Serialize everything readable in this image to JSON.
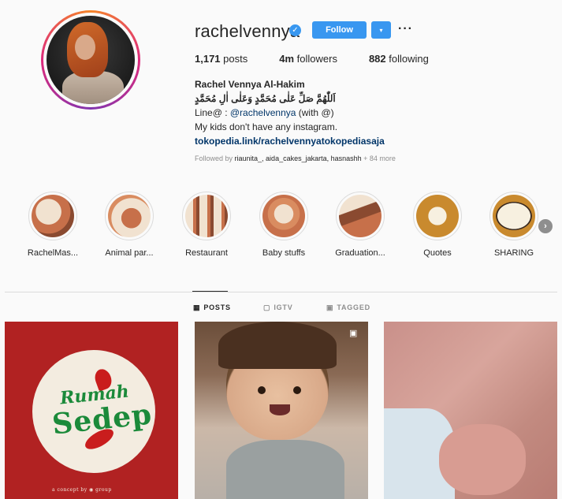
{
  "profile": {
    "username": "rachelvennya",
    "follow_label": "Follow",
    "dropdown_label": "▾",
    "more_label": "···",
    "stats": {
      "posts_value": "1,171",
      "posts_label": " posts",
      "followers_value": "4m",
      "followers_label": " followers",
      "following_value": "882",
      "following_label": " following"
    },
    "bio": {
      "name": "Rachel Vennya Al-Hakim",
      "arabic": "اَللّٰهُمَّ صَلِّ عَلٰى مُحَمَّدٍ وَعَلٰى اٰلِ مُحَمَّدٍ",
      "line_prefix": "Line@ : ",
      "line_mention": "@rachelvennya",
      "line_suffix": " (with @)",
      "kids_line": "My kids don't have any instagram.",
      "link": "tokopedia.link/rachelvennyatokopediasaja"
    },
    "followed_by_prefix": "Followed by ",
    "followed_by_names": "riaunita_, aida_cakes_jakarta, hasnashh",
    "followed_by_more": " + 84 more"
  },
  "highlights": [
    {
      "label": "RachelMas...",
      "color": "#c7704a"
    },
    {
      "label": "Animal par...",
      "color": "#c7704a"
    },
    {
      "label": "Restaurant",
      "color": "#c7704a"
    },
    {
      "label": "Baby stuffs",
      "color": "#c7704a"
    },
    {
      "label": "Graduation...",
      "color": "#c7704a"
    },
    {
      "label": "Quotes",
      "color": "#c98a2e"
    },
    {
      "label": "SHARING",
      "color": "#c98a2e"
    }
  ],
  "tabs": [
    {
      "label": "POSTS",
      "icon": "grid-icon",
      "active": true
    },
    {
      "label": "IGTV",
      "icon": "igtv-icon",
      "active": false
    },
    {
      "label": "TAGGED",
      "icon": "tag-icon",
      "active": false
    }
  ],
  "posts": {
    "post1": {
      "rumah": "Rumah",
      "sedep": "Sedep",
      "footer": "a concept by ◉ group"
    }
  },
  "colors": {
    "accent": "#3897f0",
    "link": "#003569",
    "text": "#262626",
    "muted": "#8e8e8e"
  }
}
